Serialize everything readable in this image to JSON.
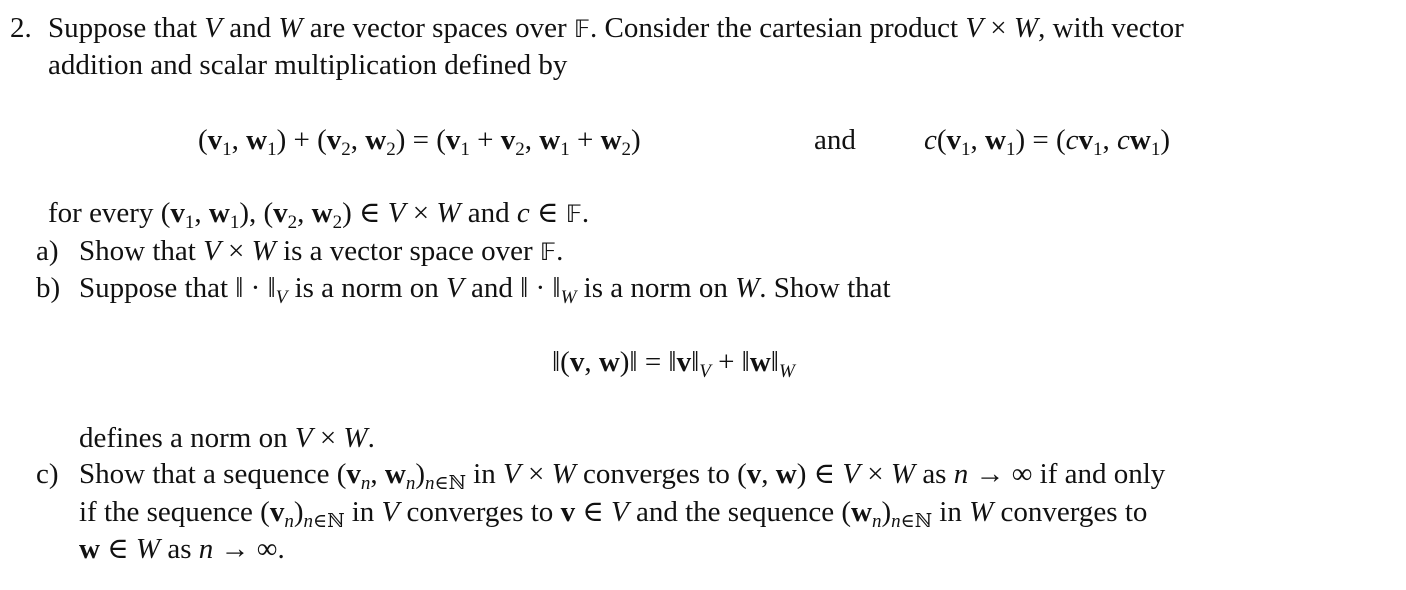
{
  "problem": {
    "number": "2.",
    "intro_line1": "Suppose that V and W are vector spaces over 𝔽. Consider the cartesian product V × W, with vector",
    "intro_line2": "addition and scalar multiplication defined by",
    "display1_left": "(v₁, w₁) + (v₂, w₂) = (v₁ + v₂, w₁ + w₂)",
    "display1_and": "and",
    "display1_right": "c(v₁, w₁) = (cv₁, cw₁)",
    "for_every": "for every (v₁, w₁), (v₂, w₂) ∈ V × W and c ∈ 𝔽.",
    "parts": [
      {
        "label": "a)",
        "text": "Show that V × W is a vector space over 𝔽."
      },
      {
        "label": "b)",
        "text": "Suppose that ‖ · ‖_V is a norm on V and ‖ · ‖_W is a norm on W. Show that",
        "display": "‖(v, w)‖ = ‖v‖_V + ‖w‖_W",
        "after": "defines a norm on V × W."
      },
      {
        "label": "c)",
        "line1": "Show that a sequence (vₙ, wₙ)_{n∈ℕ} in V × W converges to (v, w) ∈ V × W as n → ∞ if and only",
        "line2": "if the sequence (vₙ)_{n∈ℕ} in V converges to v ∈ V and the sequence (wₙ)_{n∈ℕ} in W converges to",
        "line3": "w ∈ W as n → ∞."
      }
    ]
  }
}
